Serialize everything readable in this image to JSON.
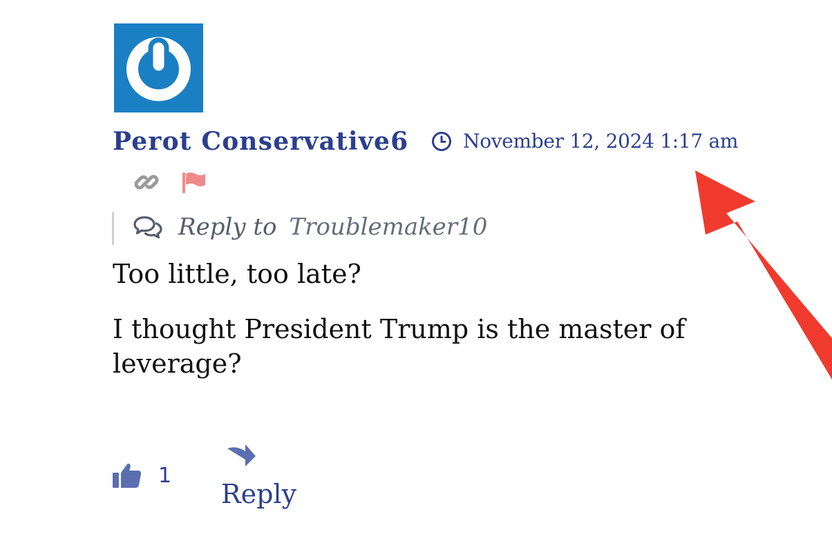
{
  "comment": {
    "avatar_icon": "power-icon",
    "author": "Perot Conservative6",
    "timestamp": "November 12, 2024 1:17 am",
    "reply_to_label": "Reply to",
    "reply_to_user": "Troublemaker10",
    "body": [
      "Too little, too late?",
      "I thought President Trump is the master of leverage?"
    ],
    "likes": "1",
    "reply_label": "Reply"
  },
  "colors": {
    "accent": "#2b3f8e",
    "avatar_bg": "#1a7fc3",
    "flag": "#ef8a8a",
    "annotation_arrow": "#f03a2e"
  }
}
